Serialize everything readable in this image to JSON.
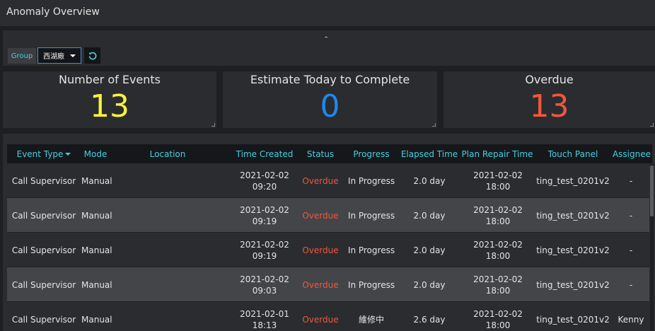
{
  "page": {
    "title": "Anomaly Overview"
  },
  "filter": {
    "dash": "-",
    "group_label": "Group",
    "group_value": "西湖廠",
    "reset_icon": "refresh-icon"
  },
  "cards": [
    {
      "label": "Number of Events",
      "value": "13",
      "color": "#fbf23c"
    },
    {
      "label": "Estimate Today to Complete",
      "value": "0",
      "color": "#1e88f0"
    },
    {
      "label": "Overdue",
      "value": "13",
      "color": "#f0573d"
    }
  ],
  "table": {
    "headers": {
      "event_type": "Event Type",
      "mode": "Mode",
      "location": "Location",
      "time_created": "Time Created",
      "status": "Status",
      "progress": "Progress",
      "elapsed_time": "Elapsed Time",
      "plan_repair_time": "Plan Repair Time",
      "touch_panel": "Touch Panel",
      "assignee": "Assignee"
    },
    "rows": [
      {
        "event_type": "Call Supervisor",
        "mode": "Manual",
        "location": "",
        "time_created": "2021-02-02 09:20",
        "status": "Overdue",
        "progress": "In Progress",
        "elapsed_time": "2.0 day",
        "plan_repair_time": "2021-02-02 18:00",
        "touch_panel": "ting_test_0201v2",
        "assignee": "-"
      },
      {
        "event_type": "Call Supervisor",
        "mode": "Manual",
        "location": "",
        "time_created": "2021-02-02 09:19",
        "status": "Overdue",
        "progress": "In Progress",
        "elapsed_time": "2.0 day",
        "plan_repair_time": "2021-02-02 18:00",
        "touch_panel": "ting_test_0201v2",
        "assignee": "-"
      },
      {
        "event_type": "Call Supervisor",
        "mode": "Manual",
        "location": "",
        "time_created": "2021-02-02 09:19",
        "status": "Overdue",
        "progress": "In Progress",
        "elapsed_time": "2.0 day",
        "plan_repair_time": "2021-02-02 18:00",
        "touch_panel": "ting_test_0201v2",
        "assignee": "-"
      },
      {
        "event_type": "Call Supervisor",
        "mode": "Manual",
        "location": "",
        "time_created": "2021-02-02 09:03",
        "status": "Overdue",
        "progress": "In Progress",
        "elapsed_time": "2.0 day",
        "plan_repair_time": "2021-02-02 18:00",
        "touch_panel": "ting_test_0201v2",
        "assignee": "-"
      },
      {
        "event_type": "Call Supervisor",
        "mode": "Manual",
        "location": "",
        "time_created": "2021-02-01 18:13",
        "status": "Overdue",
        "progress": "維修中",
        "elapsed_time": "2.6 day",
        "plan_repair_time": "2021-02-02 18:00",
        "touch_panel": "ting_test_0201v2",
        "assignee": "Kenny"
      }
    ]
  }
}
